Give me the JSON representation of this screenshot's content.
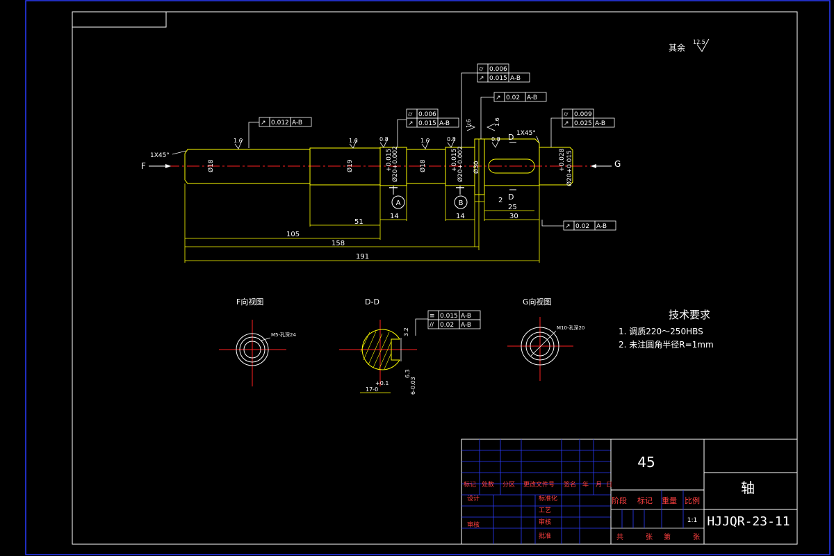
{
  "surface_note": {
    "label": "其余",
    "value": "12.5"
  },
  "views": {
    "f_view": "F向视图",
    "section": "D-D",
    "g_view": "G向视图"
  },
  "tech_requirements": {
    "title": "技术要求",
    "items": [
      "1. 调质220～250HBS",
      "2. 未注圆角半径R=1mm"
    ]
  },
  "shaft": {
    "left_arrow": "F",
    "right_arrow": "G",
    "chamfer_left": "1X45°",
    "chamfer_right": "1X45°",
    "section_mark_top": "D",
    "section_mark_bottom": "D",
    "diameters": [
      "Ø18",
      "Ø19",
      "Ø20+0.002",
      "Ø18",
      "Ø20+0.002",
      "Ø30",
      "Ø20+0.015"
    ],
    "tolerances": [
      "+0.015",
      "+0.015",
      "+0.028"
    ],
    "roughness": [
      "1.6",
      "1.6",
      "0.8",
      "1.6",
      "0.8",
      "1.6",
      "1.6",
      "0.8"
    ],
    "datums": [
      "A",
      "B"
    ],
    "dims": {
      "d105": "105",
      "d158": "158",
      "d191": "191",
      "d51": "51",
      "d14a": "14",
      "d14b": "14",
      "d2": "2",
      "d25": "25",
      "d30": "30"
    },
    "tolerance_frames": [
      {
        "id": "left",
        "rows": [
          [
            "↗",
            "0.012",
            "A-B"
          ]
        ]
      },
      {
        "id": "a",
        "rows": [
          [
            "⌭",
            "0.006",
            ""
          ],
          [
            "↗",
            "0.015",
            "A-B"
          ]
        ]
      },
      {
        "id": "b",
        "rows": [
          [
            "⌭",
            "0.006",
            ""
          ],
          [
            "↗",
            "0.015",
            "A-B"
          ]
        ]
      },
      {
        "id": "shoulder",
        "rows": [
          [
            "↗",
            "0.02",
            "A-B"
          ]
        ]
      },
      {
        "id": "right",
        "rows": [
          [
            "⌭",
            "0.009",
            ""
          ],
          [
            "↗",
            "0.025",
            "A-B"
          ]
        ]
      },
      {
        "id": "bottom",
        "rows": [
          [
            "↗",
            "0.02",
            "A-B"
          ]
        ]
      }
    ]
  },
  "f_view_label": "M5-孔深24",
  "g_view_label": "M10-孔深20",
  "section_dims": {
    "roughness": "3.2",
    "width": "6-0.03",
    "depth": "17-0",
    "depth_tol": "+0.1",
    "rough2": "6.3",
    "frames": [
      [
        "≡",
        "0.015",
        "A-B"
      ],
      [
        "//",
        "0.02",
        "A-B"
      ]
    ]
  },
  "title_block": {
    "material": "45",
    "part_name": "轴",
    "drawing_no": "HJJQR-23-11",
    "scale": "1:1",
    "header_row": [
      "标记",
      "处数",
      "分区",
      "更改文件号",
      "签名",
      "年",
      "月",
      "日"
    ],
    "left_labels": [
      "设计",
      "审核"
    ],
    "mid_labels": [
      "标准化",
      "工艺",
      "审核",
      "批准"
    ],
    "stage_row": [
      "阶段",
      "标记",
      "重量",
      "比例"
    ],
    "sheet_row": [
      "共",
      "张",
      "第",
      "张"
    ]
  },
  "colors": {
    "frame": "#2b3cff",
    "lines": "#ffff00",
    "text": "#ffffff",
    "center": "#ff2020"
  }
}
